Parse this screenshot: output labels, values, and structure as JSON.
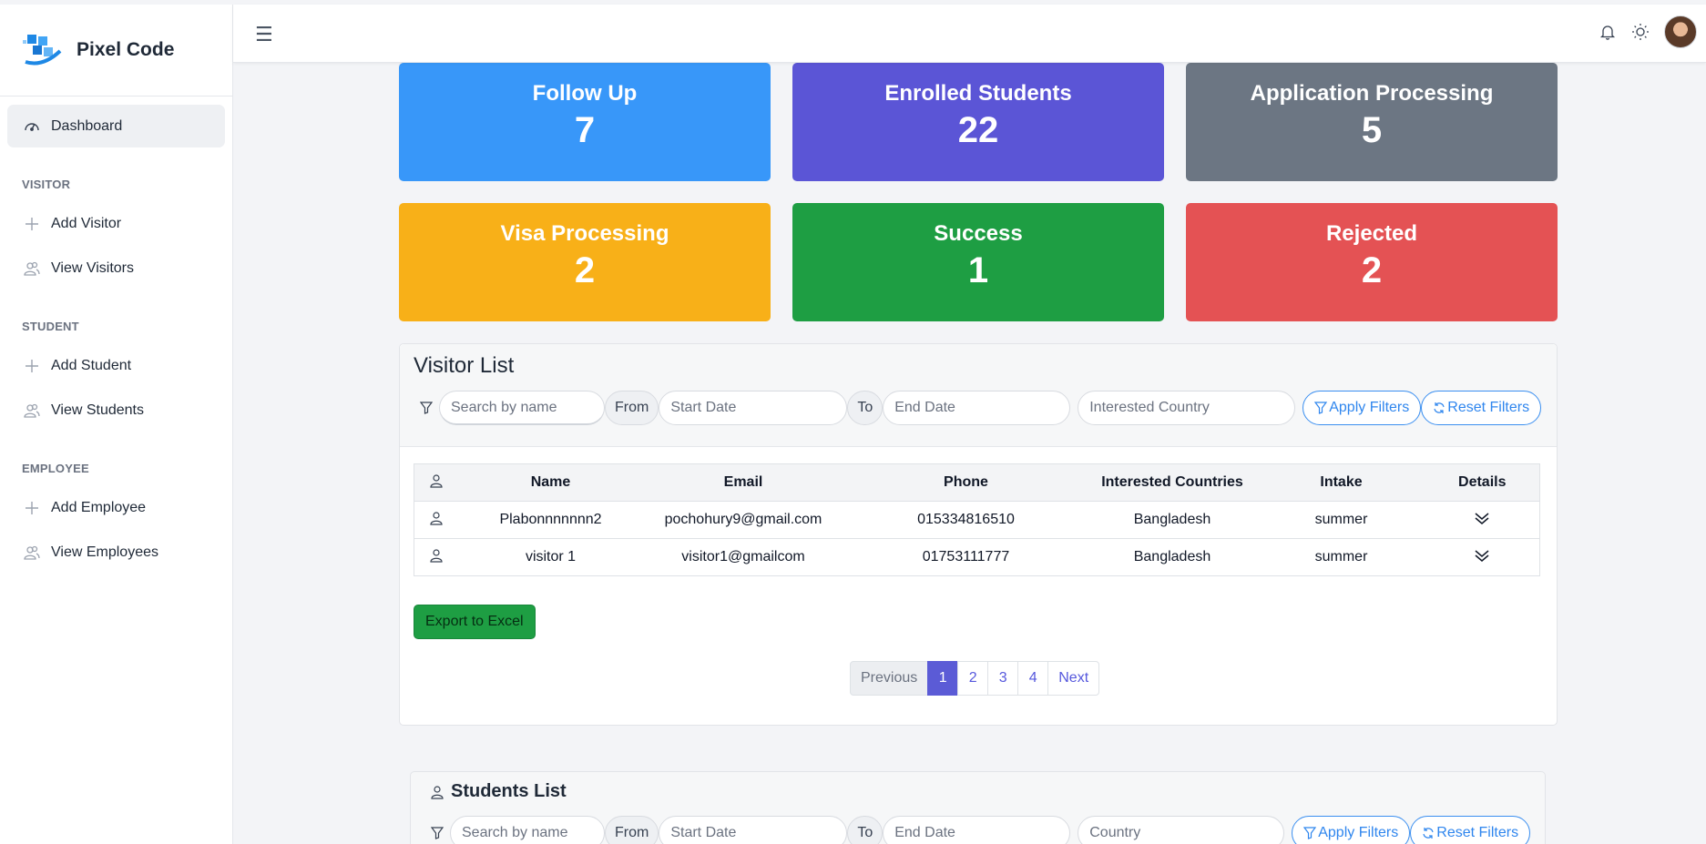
{
  "brand": {
    "name": "Pixel Code"
  },
  "sidebar": {
    "dashboard": "Dashboard",
    "sections": [
      {
        "title": "VISITOR",
        "items": [
          "Add Visitor",
          "View Visitors"
        ]
      },
      {
        "title": "STUDENT",
        "items": [
          "Add Student",
          "View Students"
        ]
      },
      {
        "title": "EMPLOYEE",
        "items": [
          "Add Employee",
          "View Employees"
        ]
      }
    ]
  },
  "topbar": {
    "menu_icon": "hamburger-icon",
    "icons": [
      "bell-icon",
      "sun-icon"
    ]
  },
  "cards": [
    {
      "title": "Follow Up",
      "value": "7",
      "color": "#3897f9"
    },
    {
      "title": "Enrolled Students",
      "value": "22",
      "color": "#5b55d6"
    },
    {
      "title": "Application Processing",
      "value": "5",
      "color": "#6c7683"
    },
    {
      "title": "Visa Processing",
      "value": "2",
      "color": "#f8b018"
    },
    {
      "title": "Success",
      "value": "1",
      "color": "#1e9e43"
    },
    {
      "title": "Rejected",
      "value": "2",
      "color": "#e45254"
    }
  ],
  "visitor_list": {
    "title": "Visitor List",
    "search_placeholder": "Search by name",
    "from_label": "From",
    "start_placeholder": "Start Date",
    "to_label": "To",
    "end_placeholder": "End Date",
    "country_placeholder": "Interested Country",
    "apply_label": "Apply Filters",
    "reset_label": "Reset Filters",
    "columns": [
      "Name",
      "Email",
      "Phone",
      "Interested Countries",
      "Intake",
      "Details"
    ],
    "rows": [
      {
        "name": "Plabonnnnnnn2",
        "email": "pochohury9@gmail.com",
        "phone": "015334816510",
        "country": "Bangladesh",
        "intake": "summer"
      },
      {
        "name": "visitor 1",
        "email": "visitor1@gmailcom",
        "phone": "01753111777",
        "country": "Bangladesh",
        "intake": "summer"
      }
    ],
    "export_label": "Export to Excel",
    "pagination": {
      "previous": "Previous",
      "pages": [
        "1",
        "2",
        "3",
        "4"
      ],
      "next": "Next",
      "current": "1"
    }
  },
  "students_list": {
    "title": "Students List",
    "search_placeholder": "Search by name",
    "from_label": "From",
    "start_placeholder": "Start Date",
    "to_label": "To",
    "end_placeholder": "End Date",
    "country_placeholder": "Country",
    "apply_label": "Apply Filters",
    "reset_label": "Reset Filters"
  }
}
